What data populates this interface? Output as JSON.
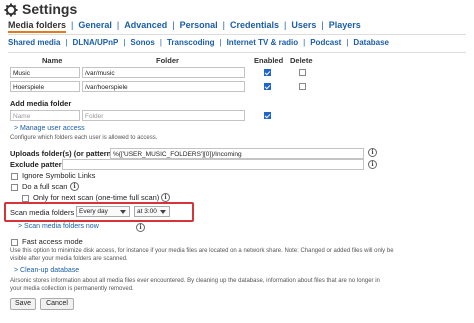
{
  "title": "Settings",
  "colors": {
    "accent": "#1b5ea8",
    "active_underline": "#e07b1f",
    "highlight": "#d6333a",
    "checkbox": "#1e66c8"
  },
  "tabs_row1": [
    "Media folders",
    "General",
    "Advanced",
    "Personal",
    "Credentials",
    "Users",
    "Players"
  ],
  "tabs_row2": [
    "Shared media",
    "DLNA/UPnP",
    "Sonos",
    "Transcoding",
    "Internet TV & radio",
    "Podcast",
    "Database"
  ],
  "tabs_sep": "|",
  "table": {
    "headers": {
      "name": "Name",
      "folder": "Folder",
      "enabled": "Enabled",
      "delete": "Delete"
    },
    "rows": [
      {
        "name": "Music",
        "folder": "/var/music",
        "enabled": true,
        "delete": false
      },
      {
        "name": "Hoerspiele",
        "folder": "/var/hoerspiele",
        "enabled": true,
        "delete": false
      }
    ]
  },
  "add_folder": {
    "label": "Add media folder",
    "name_placeholder": "Name",
    "folder_placeholder": "Folder",
    "enabled": true
  },
  "manage_user_access": {
    "link": "Manage user access",
    "hint": "Configure which folders each user is allowed to access."
  },
  "uploads": {
    "label": "Uploads folder(s) (or pattern)",
    "value": "%{['USER_MUSIC_FOLDERS'][0]}/Incoming"
  },
  "exclude": {
    "label": "Exclude pattern",
    "value": ""
  },
  "options": {
    "ignore_symlinks": "Ignore Symbolic Links",
    "full_scan": "Do a full scan",
    "next_scan_only": "Only for next scan (one-time full scan)"
  },
  "scan": {
    "label": "Scan media folders",
    "frequency": "Every day",
    "time": "at 3:00",
    "scan_now": "Scan media folders now"
  },
  "fast_access": {
    "label": "Fast access mode",
    "hint1": "Use this option to minimize disk access, for instance if your media files are located on a network share. Note: Changed or added files will only be",
    "hint2": "visible after your media folders are scanned."
  },
  "cleanup": {
    "link": "Clean-up database",
    "hint1": "Airsonic stores information about all media files ever encountered. By cleaning up the database, information about files that are no longer in",
    "hint2": "your media collection is permanently removed."
  },
  "buttons": {
    "save": "Save",
    "cancel": "Cancel"
  },
  "info_glyph": "i",
  "arrow_glyph": ">"
}
